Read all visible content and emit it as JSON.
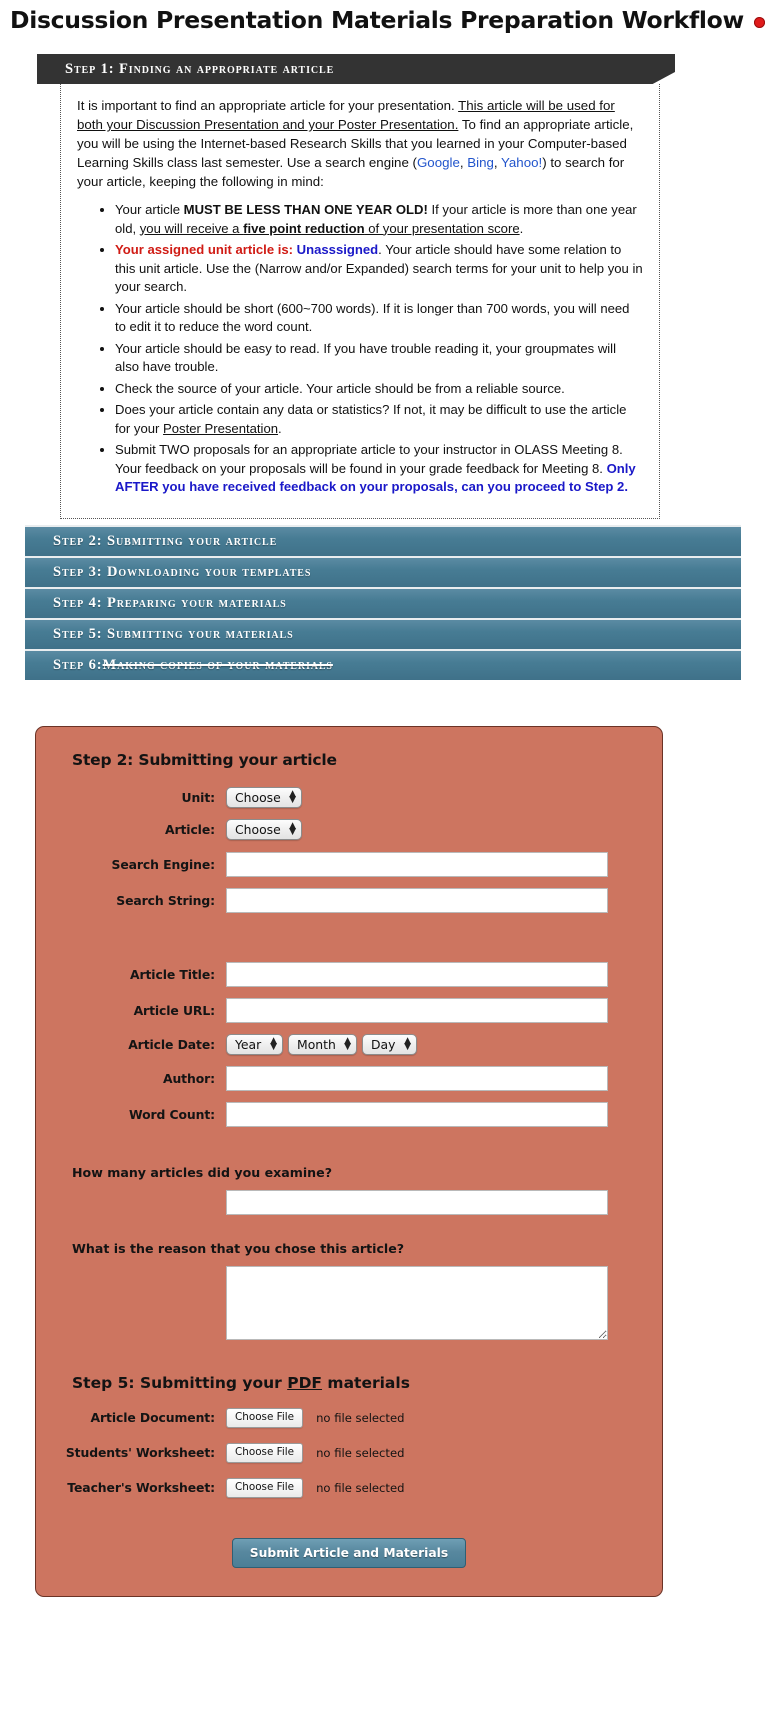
{
  "header": {
    "title": "Discussion Presentation Materials Preparation Workflow",
    "rec_indicator": "record-dot"
  },
  "accordion": {
    "step1": {
      "label": "Step 1: Finding an appropriate article",
      "state": "open",
      "intro": {
        "t1": "It is important to find an appropriate article for your presentation. ",
        "t2_underline": "This article will be used for both your Discussion Presentation and your Poster Presentation.",
        "t3": " To find an appropriate article, you will be using the Internet-based Research Skills that you learned in your Computer-based Learning Skills class last semester. Use a search engine (",
        "link1": "Google",
        "sep1": ", ",
        "link2": "Bing",
        "sep2": ", ",
        "link3": "Yahoo!",
        "t4": ") to search for your article, keeping the following in mind:"
      },
      "bullets": [
        {
          "id": "bullet-one-year-old",
          "a": "Your article ",
          "b_bold": "MUST BE LESS THAN ONE YEAR OLD!",
          "c": " If your article is more than one year old, ",
          "d_underline": "you will receive a ",
          "e_underline_bold": "five point reduction",
          "f_underline": " of your presentation score",
          "g": "."
        },
        {
          "id": "bullet-assigned-unit",
          "red": "Your assigned unit article is:",
          "blue": " Unasssigned",
          "rest": ". Your article should have some relation to this unit article. Use the (Narrow and/or Expanded) search terms for your unit to help you in your search."
        },
        {
          "id": "bullet-word-count",
          "text": "Your article should be short (600~700 words). If it is longer than 700 words, you will need to edit it to reduce the word count."
        },
        {
          "id": "bullet-easy-to-read",
          "text": "Your article should be easy to read. If you have trouble reading it, your groupmates will also have trouble."
        },
        {
          "id": "bullet-reliable-source",
          "text": "Check the source of your article. Your article should be from a reliable source."
        },
        {
          "id": "bullet-data-statistics",
          "a": "Does your article contain any data or statistics? If not, it may be difficult to use the article for your ",
          "b_underline": "Poster Presentation",
          "c": "."
        },
        {
          "id": "bullet-two-proposals",
          "a": "Submit TWO proposals for an appropriate article to your instructor in OLASS Meeting 8. Your feedback on your proposals will be found in your grade feedback for Meeting 8. ",
          "b_bold_blue": "Only AFTER you have received feedback on your proposals, can you proceed to Step 2."
        }
      ]
    },
    "closed_steps": [
      {
        "id": "step-2",
        "label": "Step 2: Submitting your article",
        "strikethrough": false
      },
      {
        "id": "step-3",
        "label": "Step 3: Downloading your templates",
        "strikethrough": false
      },
      {
        "id": "step-4",
        "label": "Step 4: Preparing your materials",
        "strikethrough": false
      },
      {
        "id": "step-5",
        "label": "Step 5: Submitting your materials",
        "strikethrough": false
      },
      {
        "id": "step-6",
        "label_prefix": "Step 6: ",
        "label_struck": "Making copies of your materials",
        "strikethrough": true
      }
    ]
  },
  "form": {
    "heading": "Step 2: Submitting your article",
    "fields": {
      "unit_label": "Unit:",
      "unit_value": "Choose",
      "article_label": "Article:",
      "article_value": "Choose",
      "search_engine_label": "Search Engine:",
      "search_engine_value": "",
      "search_string_label": "Search String:",
      "search_string_value": "",
      "article_title_label": "Article Title:",
      "article_title_value": "",
      "article_url_label": "Article URL:",
      "article_url_value": "",
      "article_date_label": "Article Date:",
      "date_year_value": "Year",
      "date_month_value": "Month",
      "date_day_value": "Day",
      "author_label": "Author:",
      "author_value": "",
      "word_count_label": "Word Count:",
      "word_count_value": ""
    },
    "questions": {
      "how_many_label": "How many articles did you examine?",
      "how_many_value": "",
      "reason_label": "What is the reason that you chose this article?",
      "reason_value": ""
    },
    "pdf_section": {
      "heading_a": "Step 5: Submitting your ",
      "heading_pdf": "PDF",
      "heading_b": " materials",
      "rows": [
        {
          "label": "Article Document:",
          "button": "Choose File",
          "status": "no file selected"
        },
        {
          "label": "Students' Worksheet:",
          "button": "Choose File",
          "status": "no file selected"
        },
        {
          "label": "Teacher's Worksheet:",
          "button": "Choose File",
          "status": "no file selected"
        }
      ]
    },
    "submit_label": "Submit Article and Materials"
  },
  "colors": {
    "open_header_bg": "#333333",
    "closed_header_bg": "#487d95",
    "form_bg": "#cd7560",
    "form_border": "#6b3326",
    "submit_bg": "#58889f",
    "link": "#2255cc",
    "alert_red": "#d01b14",
    "alert_blue": "#1a18c8",
    "rec_dot": "#e01b1b"
  }
}
